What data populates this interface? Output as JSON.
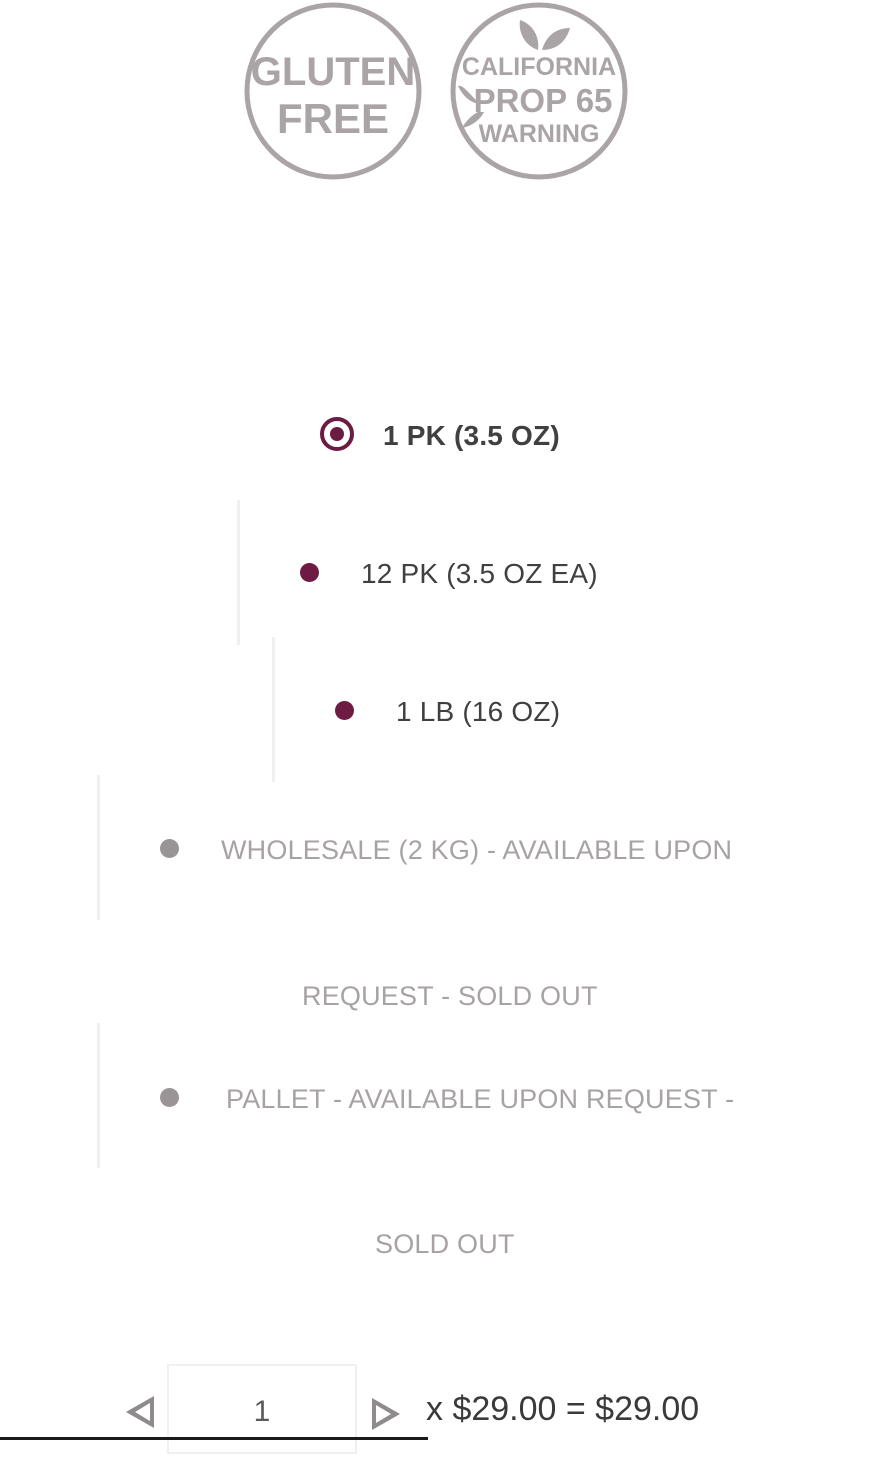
{
  "badges": [
    {
      "name": "gluten-free",
      "lines": [
        "GLUTEN",
        "FREE"
      ]
    },
    {
      "name": "california-prop-65-warning",
      "lines": [
        "CALIFORNIA",
        "PROP 65",
        "WARNING"
      ]
    }
  ],
  "options": [
    {
      "label": "1 PK (3.5 OZ)",
      "state": "selected"
    },
    {
      "label": "12 PK (3.5 OZ EA)",
      "state": "available"
    },
    {
      "label": "1 LB (16 OZ)",
      "state": "available"
    },
    {
      "label_line1": "WHOLESALE (2 KG) - AVAILABLE UPON",
      "label_line2": "REQUEST - SOLD OUT",
      "state": "sold-out"
    },
    {
      "label_line1": "PALLET - AVAILABLE UPON REQUEST -",
      "label_line2": "SOLD OUT",
      "state": "sold-out"
    }
  ],
  "quantity": {
    "value": "1",
    "price_text": "x $29.00 = $29.00"
  },
  "colors": {
    "accent": "#6e1b43",
    "badge_gray": "#aaa4a6",
    "sold_out_text": "#a7a2a4"
  },
  "icons": [
    "gluten-free-badge-icon",
    "prop-65-badge-icon",
    "leaf-icon",
    "decrement-arrow-icon",
    "increment-arrow-icon"
  ]
}
